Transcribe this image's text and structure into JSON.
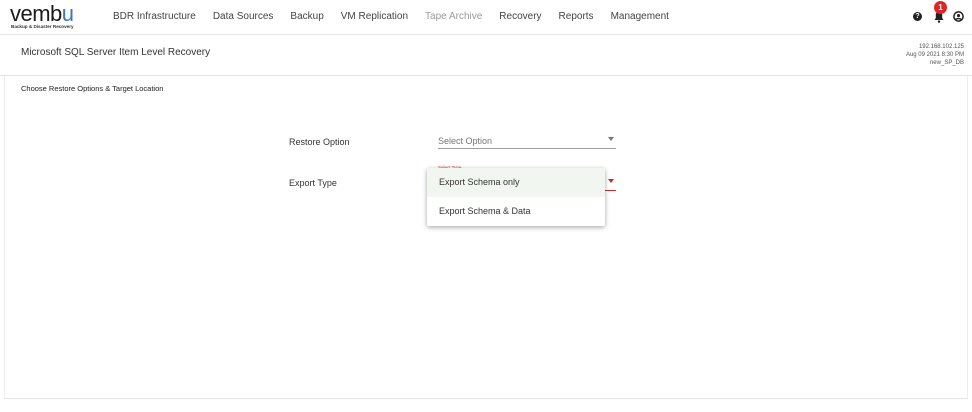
{
  "brand": {
    "name_prefix": "vemb",
    "name_suffix": "u",
    "tagline": "Backup & Disaster Recovery",
    "accent_color": "#3a76c4"
  },
  "nav": {
    "items": [
      {
        "label": "BDR Infrastructure",
        "dim": false
      },
      {
        "label": "Data Sources",
        "dim": false
      },
      {
        "label": "Backup",
        "dim": false
      },
      {
        "label": "VM Replication",
        "dim": false
      },
      {
        "label": "Tape Archive",
        "dim": true
      },
      {
        "label": "Recovery",
        "dim": false
      },
      {
        "label": "Reports",
        "dim": false
      },
      {
        "label": "Management",
        "dim": false
      }
    ],
    "icons": {
      "help": "help-icon",
      "notifications": "bell-icon",
      "user": "user-icon"
    },
    "notification_count": "1",
    "badge_color": "#e02424"
  },
  "header": {
    "title": "Microsoft SQL Server Item Level Recovery",
    "meta": {
      "ip": "192.168.102.125",
      "datetime": "Aug 09 2021 8:30 PM",
      "db": "new_SP_DB"
    }
  },
  "section": {
    "title": "Choose Restore Options & Target Location"
  },
  "form": {
    "restore_option": {
      "label": "Restore Option",
      "placeholder": "Select Option"
    },
    "export_type": {
      "label": "Export Type",
      "floating_label": "Select Type",
      "error_color": "#d12a2a"
    }
  },
  "dropdown": {
    "options": [
      {
        "label": "Export Schema only",
        "highlighted": true
      },
      {
        "label": "Export Schema & Data",
        "highlighted": false
      }
    ]
  }
}
